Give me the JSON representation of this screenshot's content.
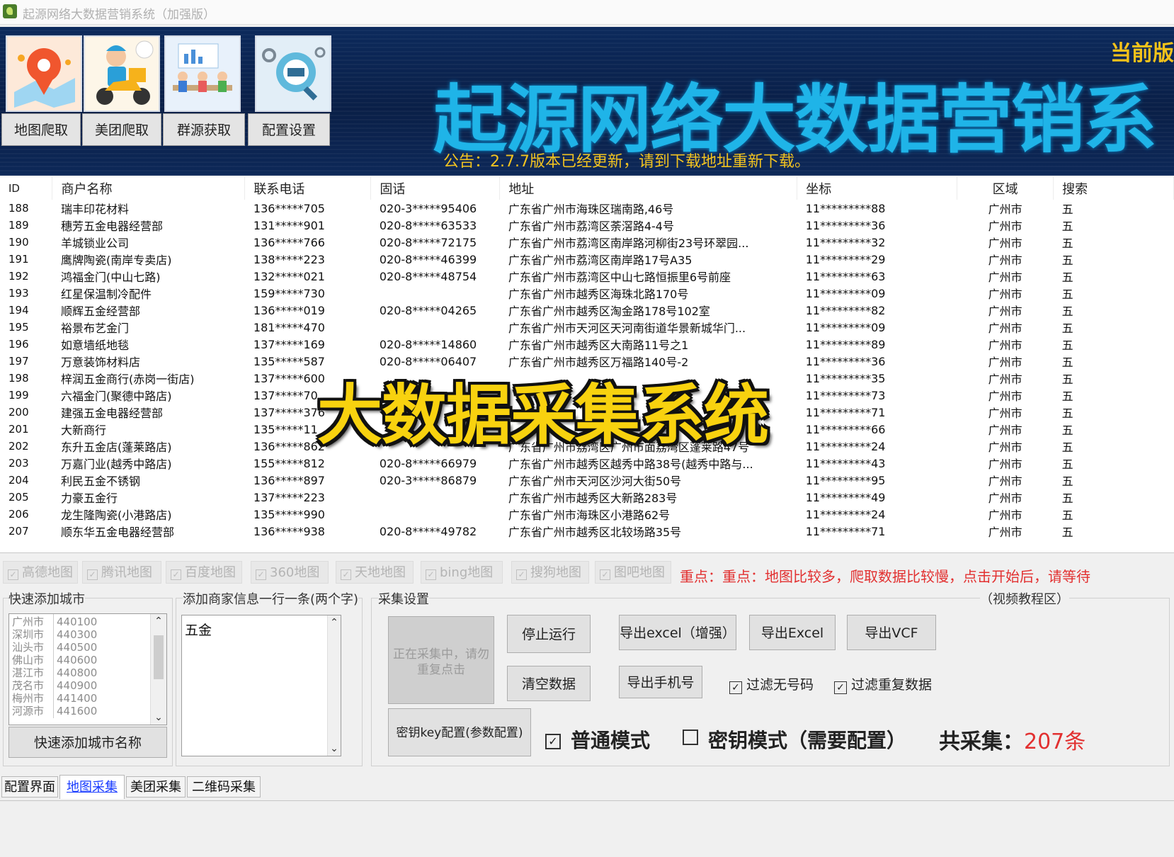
{
  "window": {
    "title": "起源网络大数据营销系统（加强版）"
  },
  "banner": {
    "tiles": [
      {
        "label": "地图爬取"
      },
      {
        "label": "美团爬取"
      },
      {
        "label": "群源获取"
      },
      {
        "label": "配置设置"
      }
    ],
    "version_label": "当前版",
    "title": "起源网络大数据营销系",
    "notice": "公告：2.7.7版本已经更新，请到下载地址重新下载。"
  },
  "table": {
    "headers": [
      "ID",
      "商户名称",
      "联系电话",
      "固话",
      "地址",
      "坐标",
      "区域",
      "搜索"
    ],
    "rows": [
      [
        "188",
        "瑞丰印花材料",
        "136*****705",
        "020-3*****95406",
        "广东省广州市海珠区瑞南路,46号",
        "11*********88",
        "广州市",
        "五"
      ],
      [
        "189",
        "穗芳五金电器经营部",
        "131*****901",
        "020-8*****63533",
        "广东省广州市荔湾区荼滘路4-4号",
        "11*********36",
        "广州市",
        "五"
      ],
      [
        "190",
        "羊城锁业公司",
        "136*****766",
        "020-8*****72175",
        "广东省广州市荔湾区南岸路河柳街23号环翠园...",
        "11*********32",
        "广州市",
        "五"
      ],
      [
        "191",
        "鹰牌陶瓷(南岸专卖店)",
        "138*****223",
        "020-8*****46399",
        "广东省广州市荔湾区南岸路17号A35",
        "11*********29",
        "广州市",
        "五"
      ],
      [
        "192",
        "鸿福金门(中山七路)",
        "132*****021",
        "020-8*****48754",
        "广东省广州市荔湾区中山七路恒振里6号前座",
        "11*********63",
        "广州市",
        "五"
      ],
      [
        "193",
        "红星保温制冷配件",
        "159*****730",
        "",
        "广东省广州市越秀区海珠北路170号",
        "11*********09",
        "广州市",
        "五"
      ],
      [
        "194",
        "顺辉五金经营部",
        "136*****019",
        "020-8*****04265",
        "广东省广州市越秀区淘金路178号102室",
        "11*********82",
        "广州市",
        "五"
      ],
      [
        "195",
        "裕景布艺金门",
        "181*****470",
        "",
        "广东省广州市天河区天河南街道华景新城华门...",
        "11*********09",
        "广州市",
        "五"
      ],
      [
        "196",
        "如意墙纸地毯",
        "137*****169",
        "020-8*****14860",
        "广东省广州市越秀区大南路11号之1",
        "11*********89",
        "广州市",
        "五"
      ],
      [
        "197",
        "万意装饰材料店",
        "135*****587",
        "020-8*****06407",
        "广东省广州市越秀区万福路140号-2",
        "11*********36",
        "广州市",
        "五"
      ],
      [
        "198",
        "梓润五金商行(赤岗一街店)",
        "137*****600",
        "",
        "",
        "11*********35",
        "广州市",
        "五"
      ],
      [
        "199",
        "六福金门(聚德中路店)",
        "137*****70",
        "",
        "",
        "11*********73",
        "广州市",
        "五"
      ],
      [
        "200",
        "建强五金电器经营部",
        "137*****376",
        "",
        "",
        "11*********71",
        "广州市",
        "五"
      ],
      [
        "201",
        "大新商行",
        "135*****11",
        "",
        "",
        "11*********66",
        "广州市",
        "五"
      ],
      [
        "202",
        "东升五金店(蓬莱路店)",
        "136*****862",
        "",
        "广东省广州市荔湾区广州市面荔湾区蓬莱路47号",
        "11*********24",
        "广州市",
        "五"
      ],
      [
        "203",
        "万嘉门业(越秀中路店)",
        "155*****812",
        "020-8*****66979",
        "广东省广州市越秀区越秀中路38号(越秀中路与...",
        "11*********43",
        "广州市",
        "五"
      ],
      [
        "204",
        "利民五金不锈钢",
        "136*****897",
        "020-3*****86879",
        "广东省广州市天河区沙河大街50号",
        "11*********95",
        "广州市",
        "五"
      ],
      [
        "205",
        "力豪五金行",
        "137*****223",
        "",
        "广东省广州市越秀区大新路283号",
        "11*********49",
        "广州市",
        "五"
      ],
      [
        "206",
        "龙生隆陶瓷(小港路店)",
        "135*****990",
        "",
        "广东省广州市海珠区小港路62号",
        "11*********24",
        "广州市",
        "五"
      ],
      [
        "207",
        "顺东华五金电器经营部",
        "136*****938",
        "020-8*****49782",
        "广东省广州市越秀区北较场路35号",
        "11*********71",
        "广州市",
        "五"
      ]
    ]
  },
  "overlay_caption": "大数据采集系统",
  "map_sources": [
    "高德地图",
    "腾讯地图",
    "百度地图",
    "360地图",
    "天地地图",
    "bing地图",
    "搜狗地图",
    "图吧地图"
  ],
  "emphasis_text": "重点：重点：地图比较多，爬取数据比较慢，点击开始后，请等待",
  "city_panel": {
    "legend": "快速添加城市",
    "cities": [
      {
        "name": "广州市",
        "code": "440100"
      },
      {
        "name": "深圳市",
        "code": "440300"
      },
      {
        "name": "汕头市",
        "code": "440500"
      },
      {
        "name": "佛山市",
        "code": "440600"
      },
      {
        "name": "湛江市",
        "code": "440800"
      },
      {
        "name": "茂名市",
        "code": "440900"
      },
      {
        "name": "梅州市",
        "code": "441400"
      },
      {
        "name": "河源市",
        "code": "441600"
      }
    ],
    "add_button": "快速添加城市名称"
  },
  "merchant_panel": {
    "legend": "添加商家信息一行一条(两个字)",
    "value": "五金"
  },
  "collect_panel": {
    "legend": "采集设置",
    "video_link": "（视频教程区）",
    "running_button": "正在采集中，请勿重复点击",
    "stop_button": "停止运行",
    "clear_button": "清空数据",
    "export_excel_plus": "导出excel（增强）",
    "export_excel": "导出Excel",
    "export_vcf": "导出VCF",
    "export_phone": "导出手机号",
    "filter_no_number": "过滤无号码",
    "filter_duplicates": "过滤重复数据",
    "key_config_button": "密钥key配置(参数配置)",
    "mode_normal": "普通模式",
    "mode_key": "密钥模式（需要配置）",
    "total_label": "共采集：",
    "total_value": "207条"
  },
  "tabs": [
    "配置界面",
    "地图采集",
    "美团采集",
    "二维码采集"
  ]
}
